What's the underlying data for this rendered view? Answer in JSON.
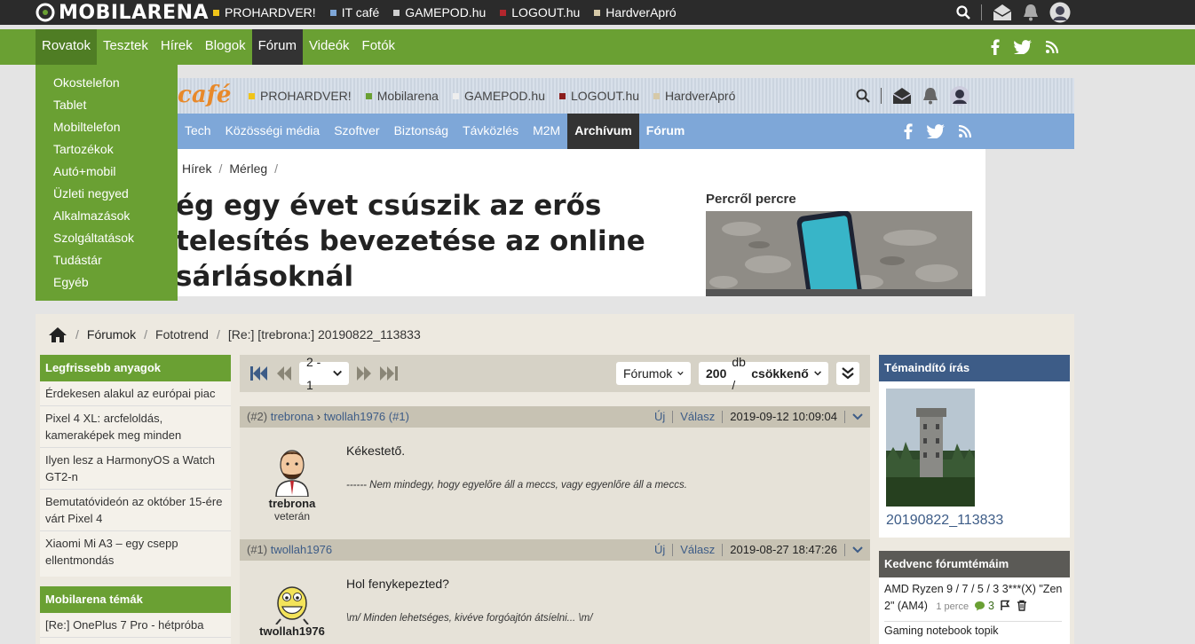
{
  "topbar": {
    "logo": "MOBILARENA",
    "links": [
      {
        "label": "PROHARDVER!",
        "color": "#f0c419"
      },
      {
        "label": "IT café",
        "color": "#7ea7d8"
      },
      {
        "label": "GAMEPOD.hu",
        "color": "#cfcfcf"
      },
      {
        "label": "LOGOUT.hu",
        "color": "#b3262d"
      },
      {
        "label": "HardverApró",
        "color": "#d6c9a8"
      }
    ]
  },
  "nav": {
    "items": [
      "Rovatok",
      "Tesztek",
      "Hírek",
      "Blogok",
      "Fórum",
      "Videók",
      "Fotók"
    ]
  },
  "dropdown": {
    "items": [
      "Okostelefon",
      "Tablet",
      "Mobiltelefon",
      "Tartozékok",
      "Autó+mobil",
      "Üzleti negyed",
      "Alkalmazások",
      "Szolgáltatások",
      "Tudástár",
      "Egyéb"
    ]
  },
  "itcafe": {
    "logo": "café",
    "links": [
      {
        "label": "PROHARDVER!",
        "color": "#f0c419"
      },
      {
        "label": "Mobilarena",
        "color": "#6aa033"
      },
      {
        "label": "GAMEPOD.hu",
        "color": "#eeeeee"
      },
      {
        "label": "LOGOUT.hu",
        "color": "#8b1d1d"
      },
      {
        "label": "HardverApró",
        "color": "#d6c9a8"
      }
    ],
    "nav": [
      "Tech",
      "Közösségi média",
      "Szoftver",
      "Biztonság",
      "Távközlés",
      "M2M",
      "Archívum",
      "Fórum"
    ],
    "breadcrumb": [
      "Hírek",
      "Mérleg"
    ],
    "headline_lines": [
      "ég egy évet csúszik az erős",
      "telesítés bevezetése az online",
      "sárlásoknál"
    ],
    "side_title": "Percről percre"
  },
  "forum": {
    "breadcrumb": [
      "Fórumok",
      "Fototrend",
      "[Re:] [trebrona:] 20190822_113833"
    ],
    "pager": {
      "page_select": "2 - 1",
      "scope_select": "Fórumok",
      "count": "200",
      "count_unit": "db /",
      "order": "csökkenő"
    },
    "posts": [
      {
        "num": "(#2)",
        "author": "trebrona",
        "reply_to": "twollah1976",
        "reply_num": "(#1)",
        "new_label": "Új",
        "reply_label": "Válasz",
        "date": "2019-09-12 10:09:04",
        "rank": "veterán",
        "text": "Kékestető.",
        "signature": "------ Nem mindegy, hogy egyelőre áll a meccs, vagy egyenlőre áll a meccs."
      },
      {
        "num": "(#1)",
        "author": "twollah1976",
        "new_label": "Új",
        "reply_label": "Válasz",
        "date": "2019-08-27 18:47:26",
        "text": "Hol fenykepezted?",
        "signature": "\\m/ Minden lehetséges, kivéve forgóajtón átsíelni... \\m/"
      }
    ]
  },
  "left_sidebar": {
    "latest_title": "Legfrissebb anyagok",
    "latest": [
      "Érdekesen alakul az európai piac",
      "Pixel 4 XL: arcfeloldás, kameraképek meg minden",
      "Ilyen lesz a HarmonyOS a Watch GT2-n",
      "Bemutatóvideón az október 15-ére várt Pixel 4",
      "Xiaomi Mi A3 – egy csepp ellentmondás"
    ],
    "topics_title": "Mobilarena témák",
    "topics": [
      "[Re:] OnePlus 7 Pro - hétpróba"
    ]
  },
  "right_sidebar": {
    "starter_title": "Témaindító írás",
    "starter_caption": "20190822_113833",
    "fav_title": "Kedvenc fórumtémáim",
    "favs": [
      {
        "title": "AMD Ryzen 9 / 7 / 5 / 3 3***(X) \"Zen 2\" (AM4)",
        "time": "1 perce",
        "count": "3"
      },
      {
        "title": "Gaming notebook topik"
      }
    ]
  },
  "colors": {
    "mobilarena_green": "#6aa033",
    "itcafe_blue": "#7ea7d8",
    "forum_link": "#3d5c87",
    "starter_head": "#3d5c87",
    "fav_head": "#5b5a56"
  }
}
